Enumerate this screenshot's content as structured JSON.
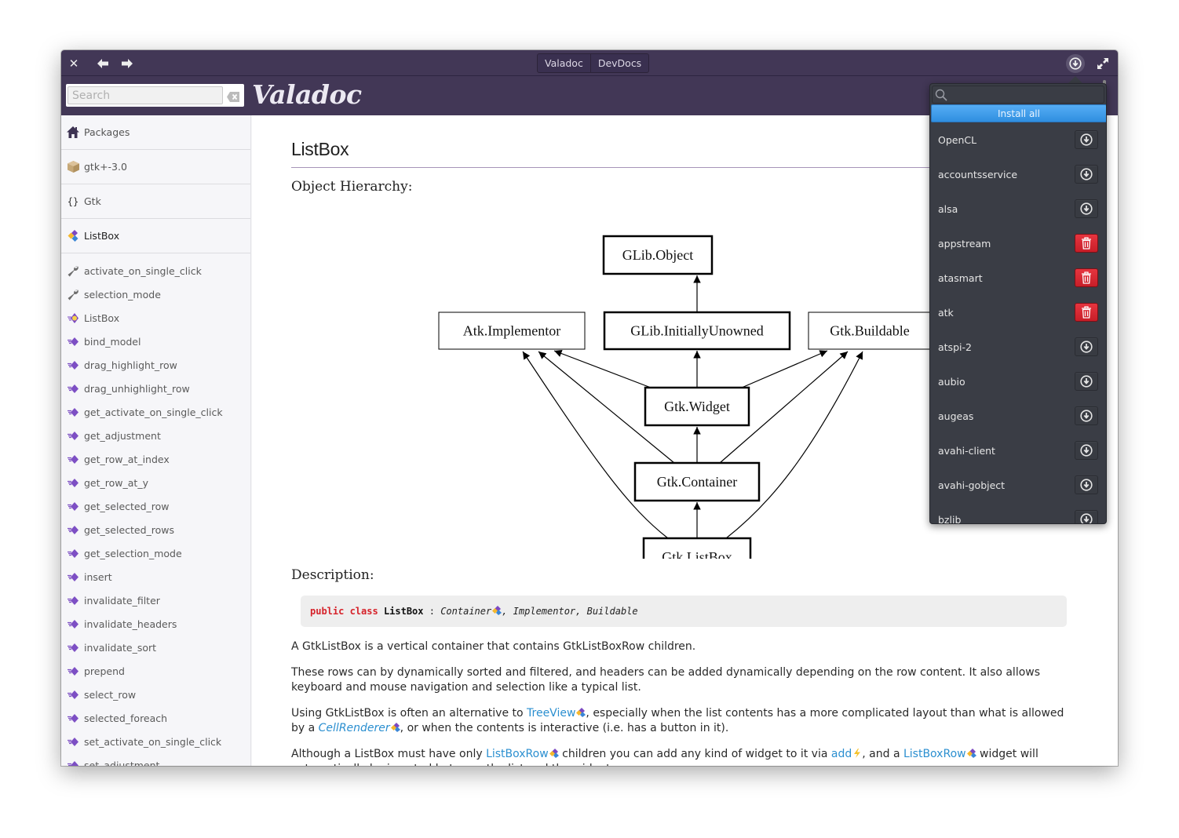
{
  "titlebar": {
    "tabs": [
      {
        "label": "Valadoc",
        "active": true
      },
      {
        "label": "DevDocs",
        "active": false
      }
    ],
    "icons": {
      "close": "close-icon",
      "back": "arrow-left-icon",
      "forward": "arrow-right-icon",
      "downloads": "download-circle-icon",
      "maximize": "maximize-icon"
    }
  },
  "header": {
    "search_placeholder": "Search",
    "search_value": "",
    "logo": "Valadoc"
  },
  "sidebar": {
    "nav": [
      {
        "label": "Packages",
        "icon": "home-icon"
      },
      {
        "label": "gtk+-3.0",
        "icon": "package-box-icon"
      },
      {
        "label": "Gtk",
        "icon": "namespace-braces-icon"
      },
      {
        "label": "ListBox",
        "icon": "class-icon",
        "current": true
      }
    ],
    "members": [
      {
        "label": "activate_on_single_click",
        "icon": "property-wrench-icon"
      },
      {
        "label": "selection_mode",
        "icon": "property-wrench-icon"
      },
      {
        "label": "ListBox",
        "icon": "constructor-icon"
      },
      {
        "label": "bind_model",
        "icon": "method-icon"
      },
      {
        "label": "drag_highlight_row",
        "icon": "method-icon"
      },
      {
        "label": "drag_unhighlight_row",
        "icon": "method-icon"
      },
      {
        "label": "get_activate_on_single_click",
        "icon": "method-icon"
      },
      {
        "label": "get_adjustment",
        "icon": "method-icon"
      },
      {
        "label": "get_row_at_index",
        "icon": "method-icon"
      },
      {
        "label": "get_row_at_y",
        "icon": "method-icon"
      },
      {
        "label": "get_selected_row",
        "icon": "method-icon"
      },
      {
        "label": "get_selected_rows",
        "icon": "method-icon"
      },
      {
        "label": "get_selection_mode",
        "icon": "method-icon"
      },
      {
        "label": "insert",
        "icon": "method-icon"
      },
      {
        "label": "invalidate_filter",
        "icon": "method-icon"
      },
      {
        "label": "invalidate_headers",
        "icon": "method-icon"
      },
      {
        "label": "invalidate_sort",
        "icon": "method-icon"
      },
      {
        "label": "prepend",
        "icon": "method-icon"
      },
      {
        "label": "select_row",
        "icon": "method-icon"
      },
      {
        "label": "selected_foreach",
        "icon": "method-icon"
      },
      {
        "label": "set_activate_on_single_click",
        "icon": "method-icon"
      },
      {
        "label": "set_adjustment",
        "icon": "method-icon"
      }
    ]
  },
  "content": {
    "title": "ListBox",
    "hierarchy_heading": "Object Hierarchy:",
    "hierarchy": {
      "nodes": [
        {
          "id": "obj",
          "label": "GLib.Object",
          "bold": true
        },
        {
          "id": "atk",
          "label": "Atk.Implementor",
          "bold": false
        },
        {
          "id": "unowned",
          "label": "GLib.InitiallyUnowned",
          "bold": true
        },
        {
          "id": "buildable",
          "label": "Gtk.Buildable",
          "bold": false
        },
        {
          "id": "widget",
          "label": "Gtk.Widget",
          "bold": true
        },
        {
          "id": "container",
          "label": "Gtk.Container",
          "bold": true
        },
        {
          "id": "listbox",
          "label": "Gtk.ListBox",
          "bold": true
        }
      ],
      "edges": [
        [
          "unowned",
          "obj"
        ],
        [
          "widget",
          "unowned"
        ],
        [
          "widget",
          "atk"
        ],
        [
          "widget",
          "buildable"
        ],
        [
          "container",
          "widget"
        ],
        [
          "container",
          "atk"
        ],
        [
          "container",
          "buildable"
        ],
        [
          "listbox",
          "container"
        ],
        [
          "listbox",
          "atk"
        ],
        [
          "listbox",
          "buildable"
        ]
      ]
    },
    "description_heading": "Description:",
    "signature": {
      "keywords": "public class",
      "name": "ListBox",
      "sep": " : ",
      "parent": "Container",
      "rest": ", Implementor, Buildable"
    },
    "paragraphs": {
      "p1": "A GtkListBox is a vertical container that contains GtkListBoxRow children.",
      "p2": "These rows can by dynamically sorted and filtered, and headers can be added dynamically depending on the row content. It also allows keyboard and mouse navigation and selection like a typical list.",
      "p3_a": "Using GtkListBox is often an alternative to ",
      "p3_link1": "TreeView",
      "p3_b": ", especially when the list contents has a more complicated layout than what is allowed by a ",
      "p3_link2": "CellRenderer",
      "p3_c": ", or when the contents is interactive (i.e. has a button in it).",
      "p4_a": "Although a ListBox must have only ",
      "p4_link1": "ListBoxRow",
      "p4_b": " children you can add any kind of widget to it via ",
      "p4_link2": "add",
      "p4_c": ", and a ",
      "p4_link3": "ListBoxRow",
      "p4_d": " widget will",
      "p4_e": "automatically be inserted between the list and the widget."
    }
  },
  "downloads_popover": {
    "search_placeholder": "",
    "install_all_label": "Install all",
    "packages": [
      {
        "name": "OpenCL",
        "installed": false
      },
      {
        "name": "accountsservice",
        "installed": false
      },
      {
        "name": "alsa",
        "installed": false
      },
      {
        "name": "appstream",
        "installed": true
      },
      {
        "name": "atasmart",
        "installed": true
      },
      {
        "name": "atk",
        "installed": true
      },
      {
        "name": "atspi-2",
        "installed": false
      },
      {
        "name": "aubio",
        "installed": false
      },
      {
        "name": "augeas",
        "installed": false
      },
      {
        "name": "avahi-client",
        "installed": false
      },
      {
        "name": "avahi-gobject",
        "installed": false
      },
      {
        "name": "bzlib",
        "installed": false
      }
    ]
  },
  "colors": {
    "titlebar": "#423756",
    "link": "#2b8fd0",
    "install_all": "#3b9be6",
    "remove": "#d8262f",
    "popover_bg": "#3a3d45",
    "method_icon": "#7d4fc4"
  }
}
